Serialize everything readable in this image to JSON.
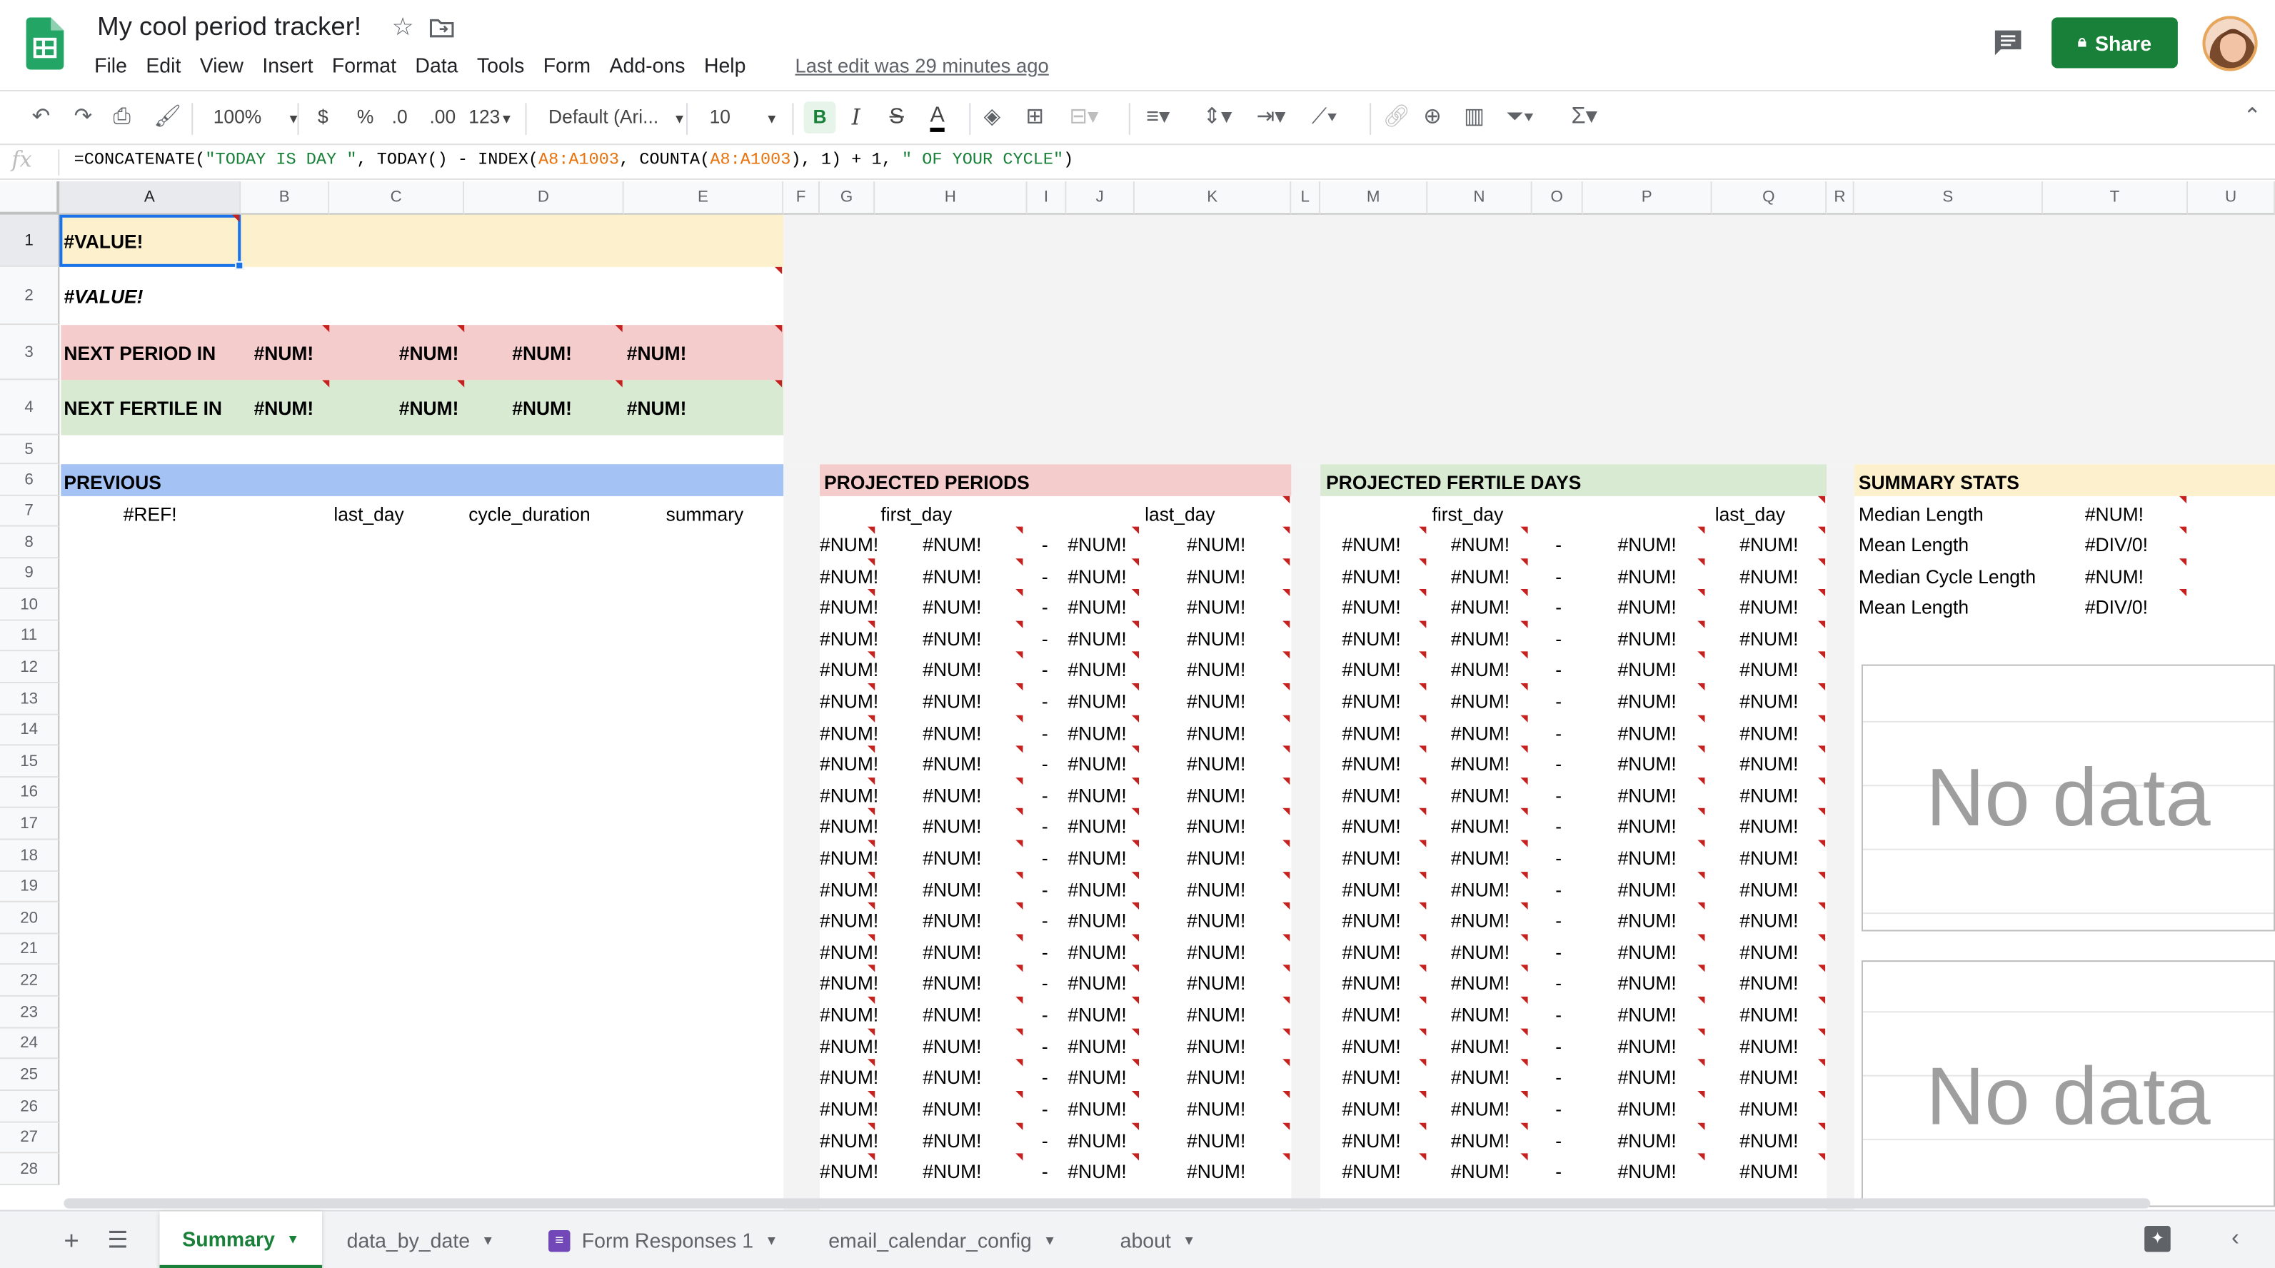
{
  "doc": {
    "title": "My cool period tracker!",
    "last_edit": "Last edit was 29 minutes ago",
    "share_label": "Share",
    "menu": [
      "File",
      "Edit",
      "View",
      "Insert",
      "Format",
      "Data",
      "Tools",
      "Form",
      "Add-ons",
      "Help"
    ]
  },
  "toolbar": {
    "zoom": "100%",
    "currency": "$",
    "percent": "%",
    "dec_decrease": ".0",
    "dec_increase": ".00",
    "more_formats": "123",
    "font": "Default (Ari...",
    "font_size": "10",
    "bold": "B",
    "italic": "I",
    "strike": "S",
    "text_color": "A",
    "sigma": "Σ"
  },
  "formula_bar": {
    "fx": "fx",
    "parts": [
      "=CONCATENATE(",
      "\"TODAY IS DAY \"",
      ", TODAY() - INDEX(",
      "A8:A1003",
      ", COUNTA(",
      "A8:A1003",
      "), 1) + 1, ",
      "\" OF YOUR CYCLE\"",
      ")"
    ]
  },
  "columns": [
    "A",
    "B",
    "C",
    "D",
    "E",
    "F",
    "G",
    "H",
    "I",
    "J",
    "K",
    "L",
    "M",
    "N",
    "O",
    "P",
    "Q",
    "R",
    "S",
    "T",
    "U"
  ],
  "rows": [
    "1",
    "2",
    "3",
    "4",
    "5",
    "6",
    "7",
    "8",
    "9",
    "10",
    "11",
    "12",
    "13",
    "14",
    "15",
    "16",
    "17",
    "18",
    "19",
    "20",
    "21",
    "22",
    "23",
    "24",
    "25",
    "26",
    "27",
    "28"
  ],
  "cells": {
    "a1": "#VALUE!",
    "a2": "#VALUE!",
    "next_period": {
      "label": "NEXT PERIOD IN",
      "values": [
        "#NUM!",
        "#NUM!",
        "#NUM!",
        "#NUM!"
      ]
    },
    "next_fertile": {
      "label": "NEXT FERTILE  IN",
      "values": [
        "#NUM!",
        "#NUM!",
        "#NUM!",
        "#NUM!"
      ]
    },
    "previous": {
      "header": "PREVIOUS",
      "cols": [
        "#REF!",
        "last_day",
        "cycle_duration",
        "summary"
      ]
    },
    "projected_periods": {
      "header": "PROJECTED PERIODS",
      "cols": [
        "first_day",
        "last_day"
      ],
      "row": [
        "#NUM!",
        "#NUM!",
        "-",
        "#NUM!",
        "#NUM!"
      ]
    },
    "projected_fertile": {
      "header": "PROJECTED FERTILE DAYS",
      "cols": [
        "first_day",
        "last_day"
      ],
      "row": [
        "#NUM!",
        "#NUM!",
        "-",
        "#NUM!",
        "#NUM!"
      ]
    },
    "summary_stats": {
      "header": "SUMMARY STATS",
      "rows": [
        {
          "label": "Median Length",
          "value": "#NUM!"
        },
        {
          "label": "Mean Length",
          "value": "#DIV/0!"
        },
        {
          "label": "Median Cycle Length",
          "value": "#NUM!"
        },
        {
          "label": "Mean Length",
          "value": "#DIV/0!"
        }
      ]
    },
    "charts": [
      "No data",
      "No data"
    ]
  },
  "tabs": [
    "Summary",
    "data_by_date",
    "Form Responses 1",
    "email_calendar_config",
    "about"
  ],
  "colors": {
    "yellow": "#fdf1cd",
    "red": "#f4cccc",
    "green": "#d9ead3",
    "blue": "#a4c2f4",
    "accent": "#188038"
  }
}
